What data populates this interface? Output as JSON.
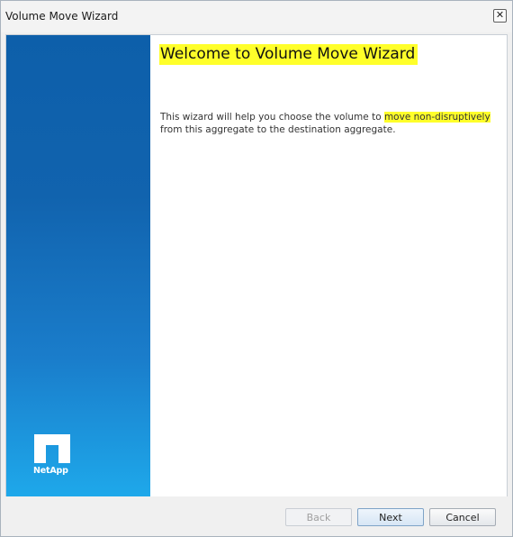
{
  "window": {
    "title": "Volume Move Wizard",
    "close_glyph": "✕"
  },
  "side_panel": {
    "logo_text": "NetApp",
    "logo_icon": "netapp-logo-icon"
  },
  "main": {
    "heading": "Welcome to Volume Move Wizard",
    "description_before": "This wizard will help you choose the volume to ",
    "description_highlight": "move non-disruptively",
    "description_after": " from this aggregate to the destination aggregate."
  },
  "footer": {
    "back_label": "Back",
    "next_label": "Next",
    "cancel_label": "Cancel"
  },
  "colors": {
    "highlight": "#ffff2a",
    "side_panel_top": "#0d5faa",
    "side_panel_bottom": "#1ea8ea"
  }
}
